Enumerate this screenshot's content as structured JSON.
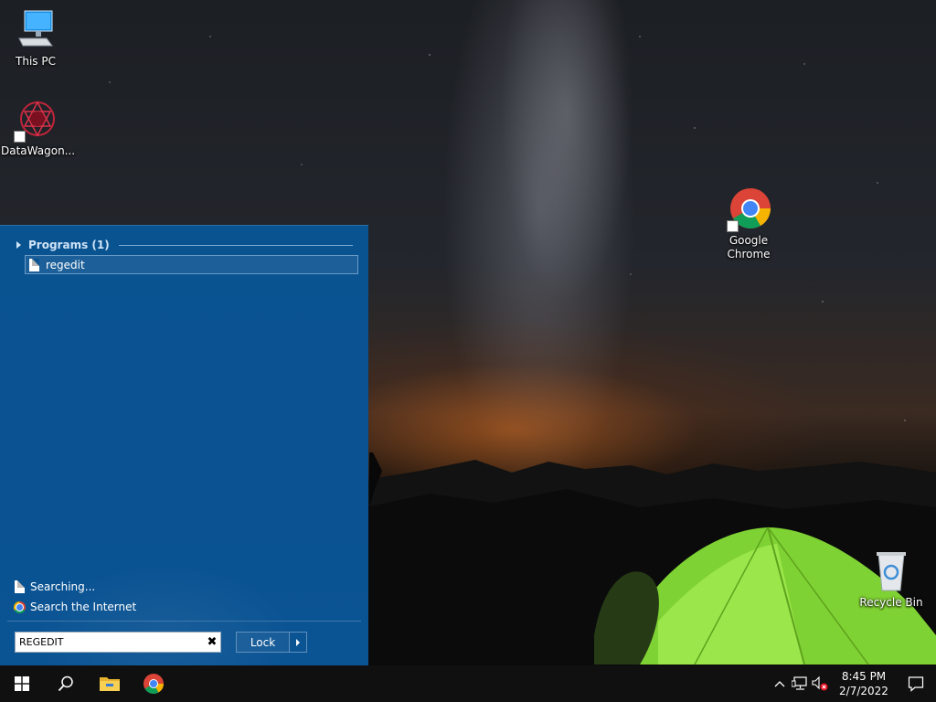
{
  "desktop": {
    "icons": [
      {
        "label": "This PC"
      },
      {
        "label": "DataWagon..."
      },
      {
        "label": "Google Chrome"
      },
      {
        "label": "Recycle Bin"
      }
    ]
  },
  "start_panel": {
    "group_header": "Programs (1)",
    "result_item": "regedit",
    "searching_label": "Searching...",
    "search_internet_label": "Search the Internet",
    "search_value": "REGEDIT",
    "clear_symbol": "✖",
    "lock_label": "Lock"
  },
  "taskbar": {
    "time": "8:45 PM",
    "date": "2/7/2022"
  },
  "colors": {
    "panel_bg": "#0a5391",
    "taskbar_bg": "#101010",
    "tent_green": "#8ee03a"
  },
  "icons": [
    "windows-logo-icon",
    "search-icon",
    "file-explorer-icon",
    "chrome-icon",
    "chevron-up-icon",
    "network-icon",
    "volume-muted-icon",
    "notification-icon"
  ]
}
